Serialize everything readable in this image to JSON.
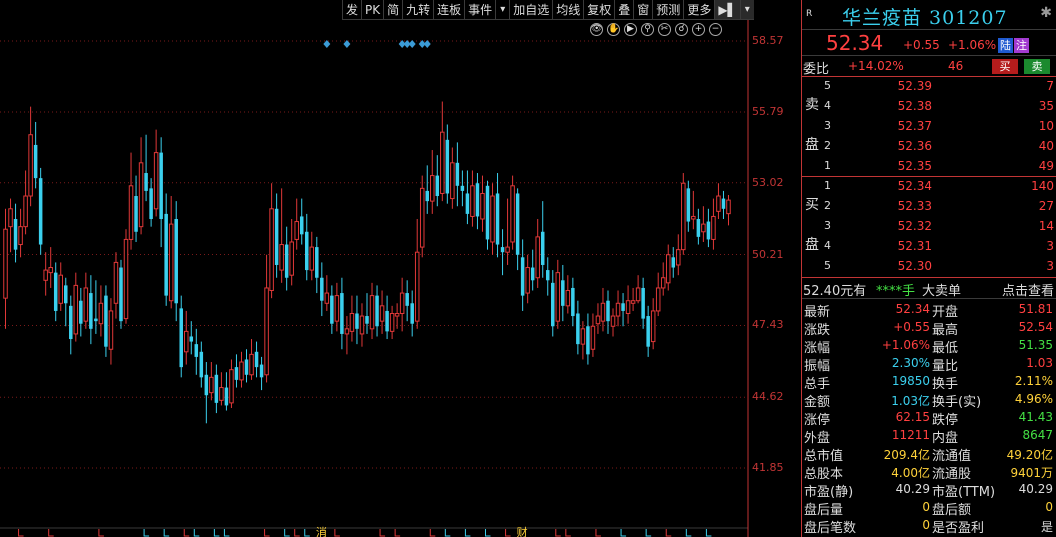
{
  "toolbar": [
    "发",
    "PK",
    "简",
    "九转",
    "连板",
    "事件",
    "▾",
    "加自选",
    "均线",
    "复权",
    "叠",
    "窗",
    "预测",
    "更多",
    "▶▌",
    "▾"
  ],
  "tools": [
    "👁",
    "✋",
    "▶",
    "⚲",
    "✂",
    "☌",
    "+",
    "−"
  ],
  "colors": {
    "up": "#e03838",
    "down": "#3bd0ee",
    "price_red": "#ff4040",
    "green": "#44e044"
  },
  "chart_data": {
    "type": "candlestick",
    "y_ticks": [
      "58.57",
      "55.79",
      "53.02",
      "50.21",
      "47.43",
      "44.62",
      "41.85"
    ],
    "ylim": [
      41.85,
      58.57
    ],
    "candles": [
      [
        48.5,
        51.2,
        52.0,
        47.3
      ],
      [
        51.3,
        52.0,
        52.4,
        50.3
      ],
      [
        51.6,
        50.4,
        52.2,
        49.9
      ],
      [
        50.6,
        51.3,
        52.0,
        50.1
      ],
      [
        51.3,
        52.5,
        53.5,
        51.0
      ],
      [
        52.5,
        54.9,
        56.0,
        52.1
      ],
      [
        54.5,
        53.2,
        55.4,
        52.8
      ],
      [
        53.2,
        50.6,
        53.6,
        50.2
      ],
      [
        49.2,
        49.6,
        50.3,
        48.6
      ],
      [
        49.5,
        49.7,
        50.5,
        48.9
      ],
      [
        49.5,
        48.0,
        49.9,
        47.6
      ],
      [
        48.3,
        49.4,
        49.9,
        48.0
      ],
      [
        49.0,
        48.3,
        49.3,
        47.4
      ],
      [
        48.2,
        46.9,
        48.6,
        46.3
      ],
      [
        47.1,
        49.0,
        49.5,
        46.8
      ],
      [
        48.4,
        47.5,
        48.9,
        47.0
      ],
      [
        47.6,
        48.9,
        49.5,
        47.3
      ],
      [
        48.7,
        47.3,
        49.4,
        46.7
      ],
      [
        47.7,
        47.6,
        49.2,
        47.1
      ],
      [
        47.5,
        48.3,
        49.0,
        47.0
      ],
      [
        48.6,
        46.6,
        49.0,
        46.2
      ],
      [
        46.5,
        48.0,
        48.5,
        45.9
      ],
      [
        48.3,
        49.9,
        50.3,
        47.7
      ],
      [
        49.7,
        47.6,
        50.0,
        47.3
      ],
      [
        47.7,
        50.8,
        51.2,
        47.5
      ],
      [
        50.8,
        52.9,
        54.2,
        50.4
      ],
      [
        52.5,
        51.1,
        53.3,
        50.7
      ],
      [
        51.3,
        53.8,
        54.8,
        51.0
      ],
      [
        53.4,
        52.7,
        54.9,
        52.3
      ],
      [
        52.8,
        51.6,
        53.2,
        51.3
      ],
      [
        52.0,
        54.2,
        55.1,
        51.7
      ],
      [
        54.2,
        51.6,
        54.8,
        50.5
      ],
      [
        51.8,
        48.6,
        52.6,
        48.2
      ],
      [
        48.4,
        51.4,
        52.5,
        48.1
      ],
      [
        51.6,
        48.3,
        52.3,
        47.6
      ],
      [
        48.1,
        45.8,
        48.6,
        45.4
      ],
      [
        46.4,
        47.2,
        48.0,
        45.9
      ],
      [
        47.0,
        46.8,
        47.6,
        46.3
      ],
      [
        46.7,
        46.2,
        47.3,
        45.5
      ],
      [
        46.4,
        45.4,
        46.8,
        45.0
      ],
      [
        45.5,
        44.7,
        46.0,
        43.6
      ],
      [
        44.8,
        45.4,
        46.0,
        44.5
      ],
      [
        45.5,
        44.4,
        45.9,
        44.0
      ],
      [
        44.5,
        45.0,
        45.6,
        44.3
      ],
      [
        45.0,
        44.3,
        45.6,
        44.1
      ],
      [
        44.4,
        45.7,
        46.1,
        44.2
      ],
      [
        45.8,
        45.3,
        46.3,
        45.0
      ],
      [
        45.3,
        46.0,
        46.4,
        45.0
      ],
      [
        46.1,
        45.5,
        46.5,
        45.2
      ],
      [
        45.5,
        46.3,
        46.9,
        45.3
      ],
      [
        46.4,
        45.8,
        46.8,
        45.4
      ],
      [
        45.9,
        45.4,
        46.2,
        44.9
      ],
      [
        45.5,
        48.9,
        50.2,
        45.2
      ],
      [
        48.8,
        52.0,
        53.0,
        48.5
      ],
      [
        52.0,
        49.8,
        52.6,
        49.3
      ],
      [
        49.6,
        50.6,
        52.8,
        49.1
      ],
      [
        50.6,
        49.3,
        51.3,
        48.8
      ],
      [
        49.4,
        50.7,
        51.6,
        49.0
      ],
      [
        50.8,
        51.5,
        52.4,
        50.4
      ],
      [
        51.7,
        51.0,
        52.4,
        50.6
      ],
      [
        51.1,
        49.6,
        51.8,
        49.2
      ],
      [
        49.6,
        50.5,
        51.1,
        49.2
      ],
      [
        50.5,
        49.3,
        50.9,
        48.7
      ],
      [
        49.3,
        48.4,
        49.9,
        47.8
      ],
      [
        48.3,
        48.7,
        49.4,
        48.0
      ],
      [
        48.6,
        47.5,
        49.0,
        47.1
      ],
      [
        47.6,
        48.6,
        49.1,
        47.2
      ],
      [
        48.7,
        47.1,
        49.3,
        46.5
      ],
      [
        47.1,
        47.3,
        47.8,
        46.3
      ],
      [
        47.2,
        47.9,
        48.6,
        46.8
      ],
      [
        47.9,
        47.3,
        48.6,
        46.7
      ],
      [
        47.1,
        47.8,
        48.3,
        46.6
      ],
      [
        47.8,
        47.5,
        48.7,
        47.1
      ],
      [
        47.3,
        48.6,
        49.1,
        46.9
      ],
      [
        48.6,
        47.4,
        49.0,
        47.0
      ],
      [
        47.6,
        48.2,
        48.8,
        47.1
      ],
      [
        48.0,
        47.2,
        48.6,
        46.9
      ],
      [
        47.2,
        47.9,
        48.2,
        46.9
      ],
      [
        47.8,
        47.9,
        48.3,
        47.3
      ],
      [
        47.9,
        48.7,
        49.3,
        47.2
      ],
      [
        48.7,
        48.2,
        49.2,
        47.6
      ],
      [
        48.3,
        47.5,
        48.8,
        47.0
      ],
      [
        47.6,
        50.3,
        51.6,
        47.3
      ],
      [
        50.5,
        52.8,
        53.3,
        50.1
      ],
      [
        52.7,
        52.3,
        53.7,
        51.8
      ],
      [
        52.3,
        53.3,
        54.3,
        51.8
      ],
      [
        53.3,
        52.5,
        54.1,
        52.1
      ],
      [
        52.6,
        55.0,
        56.2,
        52.3
      ],
      [
        54.7,
        52.6,
        55.3,
        52.2
      ],
      [
        52.4,
        53.8,
        54.4,
        52.0
      ],
      [
        53.8,
        52.9,
        54.6,
        52.1
      ],
      [
        52.9,
        52.7,
        53.5,
        52.1
      ],
      [
        52.6,
        51.8,
        53.5,
        51.4
      ],
      [
        51.7,
        52.9,
        53.5,
        51.3
      ],
      [
        53.0,
        51.7,
        53.4,
        51.2
      ],
      [
        51.6,
        52.6,
        53.3,
        51.1
      ],
      [
        52.9,
        50.8,
        53.1,
        50.4
      ],
      [
        50.7,
        52.5,
        53.0,
        50.2
      ],
      [
        52.6,
        50.6,
        53.4,
        50.1
      ],
      [
        50.5,
        50.3,
        51.2,
        49.4
      ],
      [
        50.3,
        50.5,
        52.4,
        49.8
      ],
      [
        50.7,
        52.9,
        53.3,
        50.4
      ],
      [
        52.6,
        50.2,
        52.8,
        49.6
      ],
      [
        50.1,
        48.6,
        50.8,
        48.0
      ],
      [
        48.7,
        49.7,
        50.2,
        48.3
      ],
      [
        49.7,
        49.2,
        50.4,
        48.8
      ],
      [
        49.3,
        50.9,
        51.6,
        48.9
      ],
      [
        51.1,
        49.8,
        52.3,
        49.3
      ],
      [
        49.6,
        49.2,
        50.1,
        48.6
      ],
      [
        49.1,
        47.4,
        49.6,
        47.0
      ],
      [
        47.6,
        49.5,
        50.0,
        47.3
      ],
      [
        49.2,
        48.2,
        49.8,
        47.6
      ],
      [
        48.2,
        48.8,
        49.4,
        47.9
      ],
      [
        48.9,
        47.8,
        49.3,
        47.4
      ],
      [
        47.9,
        46.7,
        48.4,
        46.3
      ],
      [
        46.7,
        47.3,
        47.6,
        46.1
      ],
      [
        47.4,
        46.3,
        47.9,
        45.9
      ],
      [
        46.5,
        47.4,
        47.9,
        46.2
      ],
      [
        47.5,
        47.8,
        48.3,
        47.1
      ],
      [
        47.6,
        48.3,
        48.9,
        47.2
      ],
      [
        48.4,
        47.6,
        48.8,
        47.1
      ],
      [
        47.4,
        47.8,
        48.1,
        47.0
      ],
      [
        47.8,
        48.3,
        48.8,
        47.4
      ],
      [
        48.3,
        48.0,
        48.7,
        47.4
      ],
      [
        47.9,
        48.4,
        49.0,
        47.5
      ],
      [
        48.3,
        48.4,
        48.9,
        48.0
      ],
      [
        48.4,
        48.9,
        49.4,
        48.3
      ],
      [
        48.9,
        47.7,
        49.3,
        47.3
      ],
      [
        47.8,
        46.6,
        48.2,
        46.2
      ],
      [
        46.8,
        48.0,
        48.5,
        46.5
      ],
      [
        48.0,
        48.9,
        49.5,
        47.8
      ],
      [
        48.9,
        49.3,
        49.9,
        48.6
      ],
      [
        49.1,
        50.2,
        50.6,
        48.8
      ],
      [
        50.1,
        49.7,
        50.5,
        49.3
      ],
      [
        49.8,
        50.4,
        51.0,
        49.4
      ],
      [
        50.4,
        53.0,
        53.4,
        50.2
      ],
      [
        52.8,
        51.5,
        53.1,
        51.1
      ],
      [
        51.6,
        51.7,
        52.7,
        51.2
      ],
      [
        51.6,
        50.9,
        52.0,
        50.6
      ],
      [
        51.1,
        51.4,
        52.1,
        50.7
      ],
      [
        51.5,
        50.8,
        52.0,
        50.5
      ],
      [
        50.8,
        51.7,
        52.4,
        50.4
      ],
      [
        51.9,
        52.5,
        53.0,
        51.6
      ],
      [
        52.4,
        52.0,
        52.7,
        51.6
      ],
      [
        51.81,
        52.34,
        52.54,
        51.35
      ]
    ],
    "markers_top": [
      64,
      68,
      79,
      80,
      81,
      83,
      84
    ],
    "bottom_marks": [
      "L",
      "L",
      "L",
      "L",
      "L",
      "L",
      "L",
      "L",
      "L",
      "L",
      "L",
      "L",
      "L",
      "L",
      "L",
      "L",
      "L",
      "L",
      "L",
      "L",
      "L",
      "L",
      "L",
      "L",
      "L",
      "L",
      "L",
      "L",
      "L",
      "L",
      "L",
      "L",
      "L",
      "L",
      "L",
      "L",
      "L",
      "L",
      "L",
      "L"
    ],
    "bottom_labels": [
      {
        "text": "消",
        "i": 63
      },
      {
        "text": "财",
        "i": 103
      }
    ]
  },
  "panel": {
    "r": "R",
    "name": "华兰疫苗 301207",
    "price": "52.34",
    "change": "+0.55",
    "pct": "+1.06%",
    "badge1": "陆",
    "badge2": "注",
    "weibi_label": "委比",
    "weibi": "+14.02%",
    "weicha": "46",
    "buy": "买",
    "sell": "卖",
    "sell_side": "卖\n\n盘",
    "buy_side": "买\n\n盘",
    "asks": [
      {
        "lvl": "5",
        "price": "52.39",
        "vol": "7"
      },
      {
        "lvl": "4",
        "price": "52.38",
        "vol": "35"
      },
      {
        "lvl": "3",
        "price": "52.37",
        "vol": "10"
      },
      {
        "lvl": "2",
        "price": "52.36",
        "vol": "40"
      },
      {
        "lvl": "1",
        "price": "52.35",
        "vol": "49"
      }
    ],
    "bids": [
      {
        "lvl": "1",
        "price": "52.34",
        "vol": "140"
      },
      {
        "lvl": "2",
        "price": "52.33",
        "vol": "27"
      },
      {
        "lvl": "3",
        "price": "52.32",
        "vol": "14"
      },
      {
        "lvl": "4",
        "price": "52.31",
        "vol": "3"
      },
      {
        "lvl": "5",
        "price": "52.30",
        "vol": "3"
      }
    ],
    "tape": {
      "t1": "52.40元有",
      "t2": "****手",
      "t3": "大卖单",
      "t4": "点击查看"
    },
    "stats": [
      {
        "l1": "最新",
        "v1": "52.34",
        "c1": "red",
        "l2": "开盘",
        "v2": "51.81",
        "c2": "red"
      },
      {
        "l1": "涨跌",
        "v1": "+0.55",
        "c1": "red",
        "l2": "最高",
        "v2": "52.54",
        "c2": "red"
      },
      {
        "l1": "涨幅",
        "v1": "+1.06%",
        "c1": "red",
        "l2": "最低",
        "v2": "51.35",
        "c2": "green"
      },
      {
        "l1": "振幅",
        "v1": "2.30%",
        "c1": "cyan",
        "l2": "量比",
        "v2": "1.03",
        "c2": "red"
      },
      {
        "l1": "总手",
        "v1": "19850",
        "c1": "cyan",
        "l2": "换手",
        "v2": "2.11%",
        "c2": "yellow"
      },
      {
        "l1": "金额",
        "v1": "1.03亿",
        "c1": "cyan",
        "l2": "换手(实)",
        "v2": "4.96%",
        "c2": "yellow"
      },
      {
        "l1": "涨停",
        "v1": "62.15",
        "c1": "red",
        "l2": "跌停",
        "v2": "41.43",
        "c2": "green"
      },
      {
        "l1": "外盘",
        "v1": "11211",
        "c1": "red",
        "l2": "内盘",
        "v2": "8647",
        "c2": "green"
      },
      {
        "l1": "总市值",
        "v1": "209.4亿",
        "c1": "yellow",
        "l2": "流通值",
        "v2": "49.20亿",
        "c2": "yellow"
      },
      {
        "l1": "总股本",
        "v1": "4.00亿",
        "c1": "yellow",
        "l2": "流通股",
        "v2": "9401万",
        "c2": "yellow"
      },
      {
        "l1": "市盈(静)",
        "v1": "40.29",
        "c1": "white",
        "l2": "市盈(TTM)",
        "v2": "40.29",
        "c2": "white"
      },
      {
        "l1": "盘后量",
        "v1": "0",
        "c1": "yellow",
        "l2": "盘后额",
        "v2": "0",
        "c2": "yellow"
      },
      {
        "l1": "盘后笔数",
        "v1": "0",
        "c1": "yellow",
        "l2": "是否盈利",
        "v2": "是",
        "c2": "white"
      }
    ]
  }
}
